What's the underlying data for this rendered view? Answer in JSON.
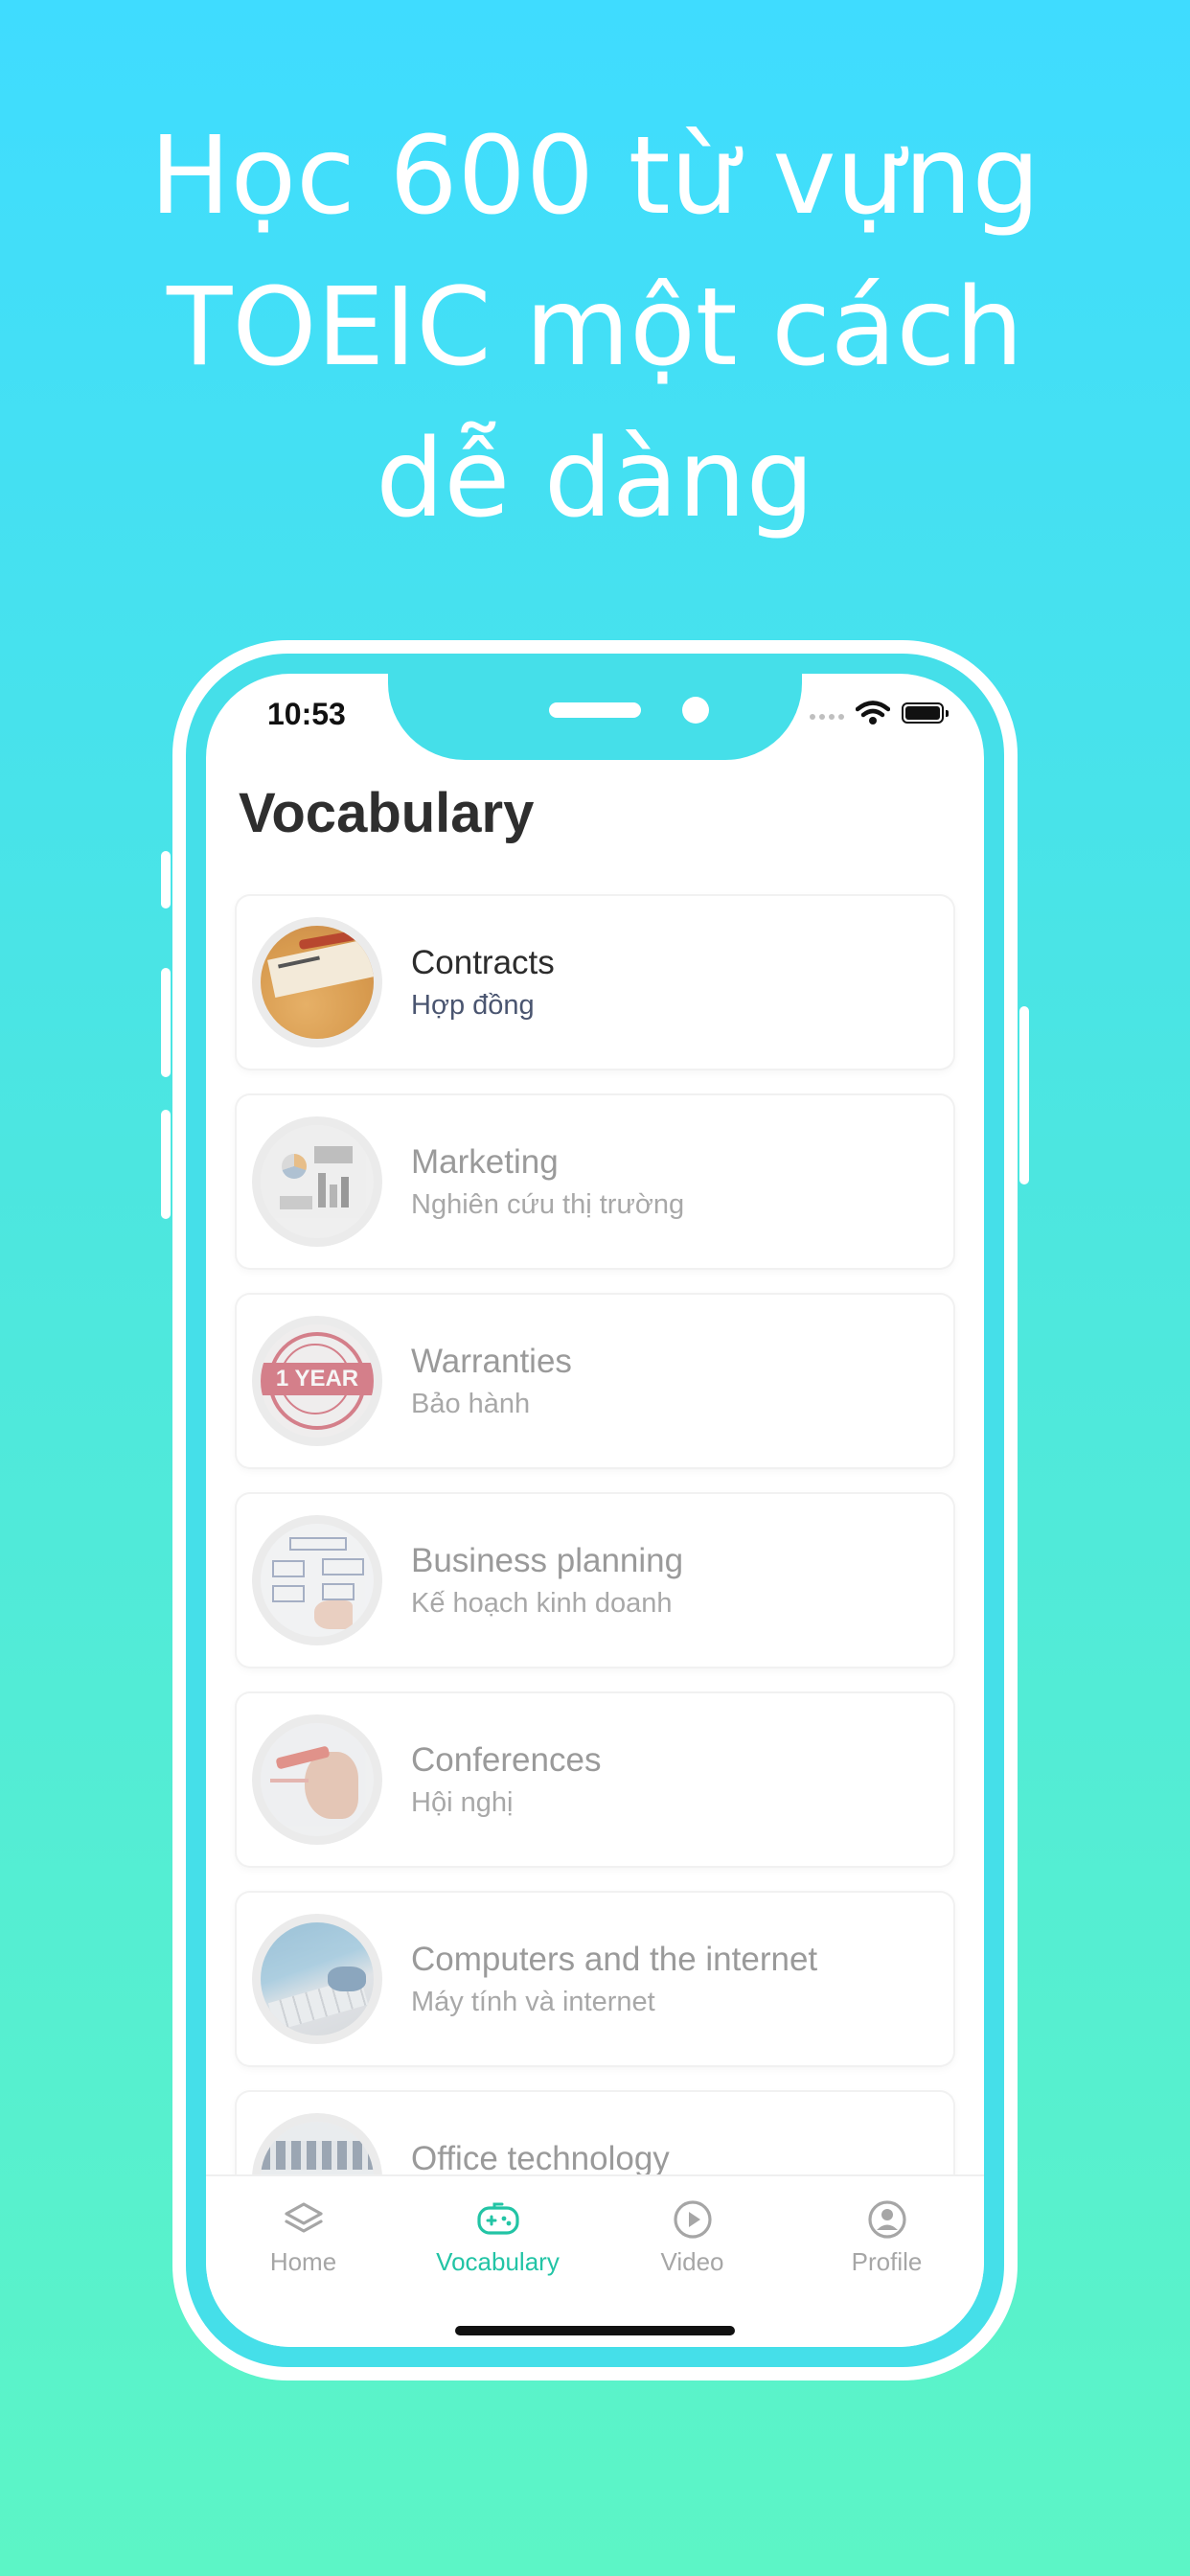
{
  "headline": {
    "line1": "Học 600 từ vựng",
    "line2": "TOEIC một cách",
    "line3": "dễ dàng"
  },
  "status_bar": {
    "time": "10:53"
  },
  "screen": {
    "title": "Vocabulary"
  },
  "topics": [
    {
      "title": "Contracts",
      "subtitle": "Hợp đồng",
      "image": "contract-paper"
    },
    {
      "title": "Marketing",
      "subtitle": "Nghiên cứu thị trường",
      "image": "marketing-charts"
    },
    {
      "title": "Warranties",
      "subtitle": "Bảo hành",
      "image": "warranty-stamp",
      "stamp_text": "1 YEAR"
    },
    {
      "title": "Business planning",
      "subtitle": "Kế hoạch kinh doanh",
      "image": "strategy-diagram"
    },
    {
      "title": "Conferences",
      "subtitle": "Hội nghị",
      "image": "hand-marker"
    },
    {
      "title": "Computers and the internet",
      "subtitle": "Máy tính và internet",
      "image": "keyboard"
    },
    {
      "title": "Office technology",
      "subtitle": "",
      "image": "office-room"
    }
  ],
  "tabbar": {
    "home": "Home",
    "vocabulary": "Vocabulary",
    "video": "Video",
    "profile": "Profile"
  },
  "colors": {
    "background_top": "#3fdcff",
    "background_bottom": "#5cf5c6",
    "accent": "#22c4a5"
  }
}
